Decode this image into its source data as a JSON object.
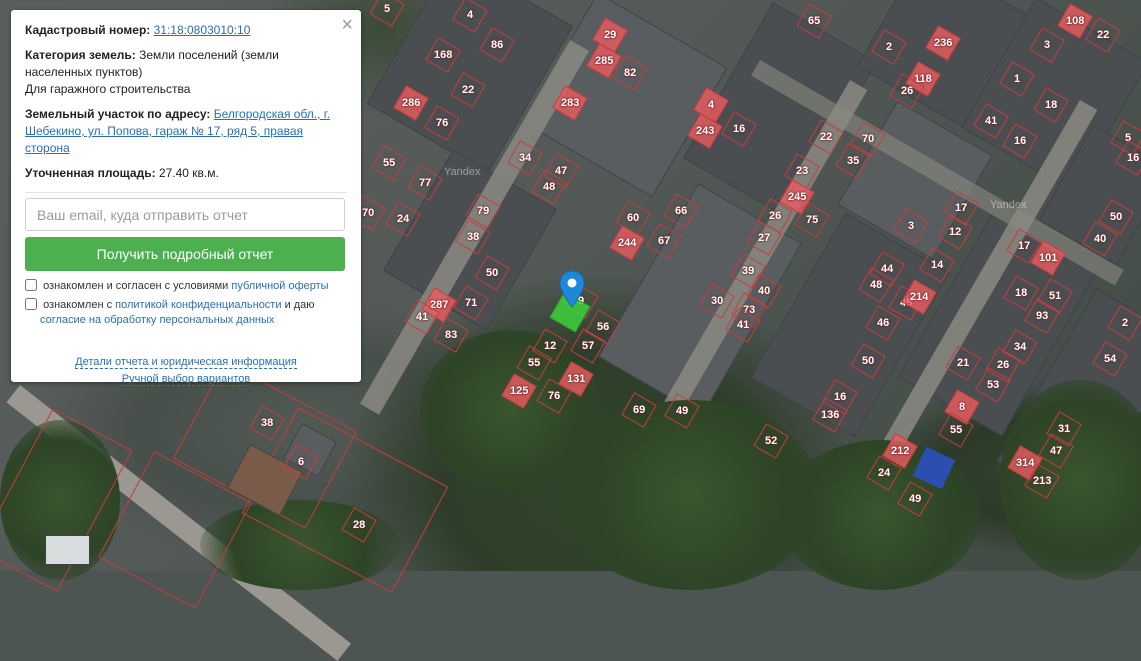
{
  "panel": {
    "cadastral_label": "Кадастровый номер:",
    "cadastral_value": "31:18:0803010:10",
    "category_label": "Категория земель:",
    "category_value": "Земли поселений (земли населенных пунктов)",
    "category_use": "Для гаражного строительства",
    "address_label": "Земельный участок по адресу:",
    "address_value": "Белгородская обл., г. Шебекино, ул. Попова, гараж № 17, ряд 5, правая сторона",
    "area_label": "Уточненная площадь:",
    "area_value": "27.40 кв.м.",
    "email_placeholder": "Ваш email, куда отправить отчет",
    "submit_label": "Получить подробный отчет",
    "consent1_text": "ознакомлен и согласен с условиями",
    "consent1_link": "публичной оферты",
    "consent2_text": "ознакомлен с",
    "consent2_link": "политикой конфиденциальности",
    "consent2_mid": "и даю",
    "consent2_link2": "согласие на обработку персональных данных",
    "details_link": "Детали отчета и юридическая информация",
    "manual_link": "Ручной выбор вариантов",
    "close_icon": "×"
  },
  "map": {
    "watermark": "Yandex",
    "plots": [
      {
        "n": "4",
        "f": 0
      },
      {
        "n": "86",
        "f": 0
      },
      {
        "n": "168",
        "f": 0
      },
      {
        "n": "22",
        "f": 0
      },
      {
        "n": "286",
        "f": 1
      },
      {
        "n": "76",
        "f": 0
      },
      {
        "n": "29",
        "f": 1
      },
      {
        "n": "285",
        "f": 1
      },
      {
        "n": "82",
        "f": 0
      },
      {
        "n": "283",
        "f": 1
      },
      {
        "n": "4",
        "f": 1
      },
      {
        "n": "243",
        "f": 1
      },
      {
        "n": "16",
        "f": 0
      },
      {
        "n": "65",
        "f": 0
      },
      {
        "n": "2",
        "f": 0
      },
      {
        "n": "236",
        "f": 1
      },
      {
        "n": "118",
        "f": 1
      },
      {
        "n": "26",
        "f": 0
      },
      {
        "n": "108",
        "f": 1
      },
      {
        "n": "22",
        "f": 0
      },
      {
        "n": "3",
        "f": 0
      },
      {
        "n": "1",
        "f": 0
      },
      {
        "n": "18",
        "f": 0
      },
      {
        "n": "41",
        "f": 0
      },
      {
        "n": "16",
        "f": 0
      },
      {
        "n": "5",
        "f": 0
      },
      {
        "n": "55",
        "f": 0
      },
      {
        "n": "77",
        "f": 0
      },
      {
        "n": "34",
        "f": 0
      },
      {
        "n": "47",
        "f": 0
      },
      {
        "n": "48",
        "f": 0
      },
      {
        "n": "22",
        "f": 0
      },
      {
        "n": "70",
        "f": 0
      },
      {
        "n": "35",
        "f": 0
      },
      {
        "n": "70",
        "f": 0
      },
      {
        "n": "24",
        "f": 0
      },
      {
        "n": "79",
        "f": 0
      },
      {
        "n": "38",
        "f": 0
      },
      {
        "n": "60",
        "f": 0
      },
      {
        "n": "244",
        "f": 1
      },
      {
        "n": "67",
        "f": 0
      },
      {
        "n": "66",
        "f": 0
      },
      {
        "n": "23",
        "f": 0
      },
      {
        "n": "245",
        "f": 1
      },
      {
        "n": "75",
        "f": 0
      },
      {
        "n": "26",
        "f": 0
      },
      {
        "n": "27",
        "f": 0
      },
      {
        "n": "17",
        "f": 0
      },
      {
        "n": "12",
        "f": 0
      },
      {
        "n": "3",
        "f": 0
      },
      {
        "n": "50",
        "f": 0
      },
      {
        "n": "40",
        "f": 0
      },
      {
        "n": "17",
        "f": 0
      },
      {
        "n": "101",
        "f": 1
      },
      {
        "n": "50",
        "f": 0
      },
      {
        "n": "287",
        "f": 1
      },
      {
        "n": "71",
        "f": 0
      },
      {
        "n": "41",
        "f": 0
      },
      {
        "n": "83",
        "f": 0
      },
      {
        "n": "9",
        "f": 0
      },
      {
        "n": "56",
        "f": 0
      },
      {
        "n": "57",
        "f": 0
      },
      {
        "n": "12",
        "f": 0
      },
      {
        "n": "55",
        "f": 0
      },
      {
        "n": "131",
        "f": 1
      },
      {
        "n": "125",
        "f": 1
      },
      {
        "n": "76",
        "f": 0
      },
      {
        "n": "39",
        "f": 0
      },
      {
        "n": "40",
        "f": 0
      },
      {
        "n": "30",
        "f": 0
      },
      {
        "n": "73",
        "f": 0
      },
      {
        "n": "41",
        "f": 0
      },
      {
        "n": "44",
        "f": 0
      },
      {
        "n": "48",
        "f": 0
      },
      {
        "n": "14",
        "f": 0
      },
      {
        "n": "45",
        "f": 0
      },
      {
        "n": "214",
        "f": 1
      },
      {
        "n": "46",
        "f": 0
      },
      {
        "n": "18",
        "f": 0
      },
      {
        "n": "51",
        "f": 0
      },
      {
        "n": "93",
        "f": 0
      },
      {
        "n": "2",
        "f": 0
      },
      {
        "n": "69",
        "f": 0
      },
      {
        "n": "49",
        "f": 0
      },
      {
        "n": "50",
        "f": 0
      },
      {
        "n": "34",
        "f": 0
      },
      {
        "n": "26",
        "f": 0
      },
      {
        "n": "21",
        "f": 0
      },
      {
        "n": "53",
        "f": 0
      },
      {
        "n": "54",
        "f": 0
      },
      {
        "n": "8",
        "f": 1
      },
      {
        "n": "16",
        "f": 0
      },
      {
        "n": "136",
        "f": 0
      },
      {
        "n": "55",
        "f": 0
      },
      {
        "n": "52",
        "f": 0
      },
      {
        "n": "212",
        "f": 1
      },
      {
        "n": "31",
        "f": 0
      },
      {
        "n": "47",
        "f": 0
      },
      {
        "n": "24",
        "f": 0
      },
      {
        "n": "314",
        "f": 1
      },
      {
        "n": "213",
        "f": 0
      },
      {
        "n": "49",
        "f": 0
      },
      {
        "n": "38",
        "f": 0
      },
      {
        "n": "6",
        "f": 0
      },
      {
        "n": "28",
        "f": 0
      },
      {
        "n": "5",
        "f": 0
      },
      {
        "n": "16",
        "f": 0
      }
    ]
  }
}
